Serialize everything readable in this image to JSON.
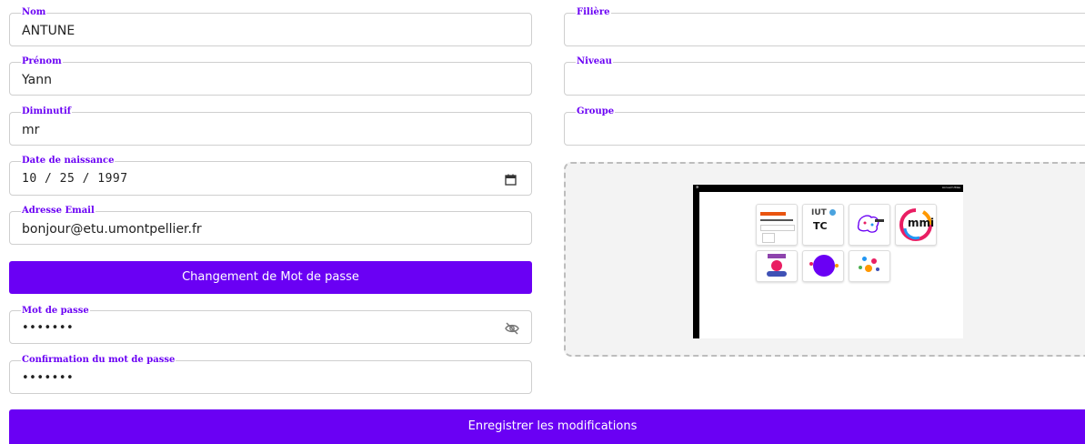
{
  "form": {
    "nom": {
      "label": "Nom",
      "value": "ANTUNE"
    },
    "prenom": {
      "label": "Prénom",
      "value": "Yann"
    },
    "diminutif": {
      "label": "Diminutif",
      "value": "mr"
    },
    "date_naissance": {
      "label": "Date de naissance",
      "value": "10 / 25 / 1997"
    },
    "email": {
      "label": "Adresse Email",
      "value": "bonjour@etu.umontpellier.fr"
    },
    "change_password_button": "Changement de Mot de passe",
    "mot_de_passe": {
      "label": "Mot de passe",
      "value": "•••••••"
    },
    "confirmation": {
      "label": "Confirmation du mot de passe",
      "value": "•••••••"
    },
    "filiere": {
      "label": "Filière",
      "value": ""
    },
    "niveau": {
      "label": "Niveau",
      "value": ""
    },
    "groupe": {
      "label": "Groupe",
      "value": ""
    },
    "save_button": "Enregistrer les modifications"
  },
  "preview": {
    "nav_links": "Accueil  Utiles",
    "tiles": [
      {
        "name": "ENT dashboard"
      },
      {
        "name": "IUT TC"
      },
      {
        "name": "Robot IA"
      },
      {
        "name": "MMI Béziers"
      },
      {
        "name": "Mascotte"
      },
      {
        "name": "Robot violet"
      },
      {
        "name": "Réseau"
      }
    ],
    "tc_text": "TC",
    "mmi_text": "mmi"
  },
  "colors": {
    "accent": "#6a00f4",
    "border": "#cfcfcf"
  }
}
